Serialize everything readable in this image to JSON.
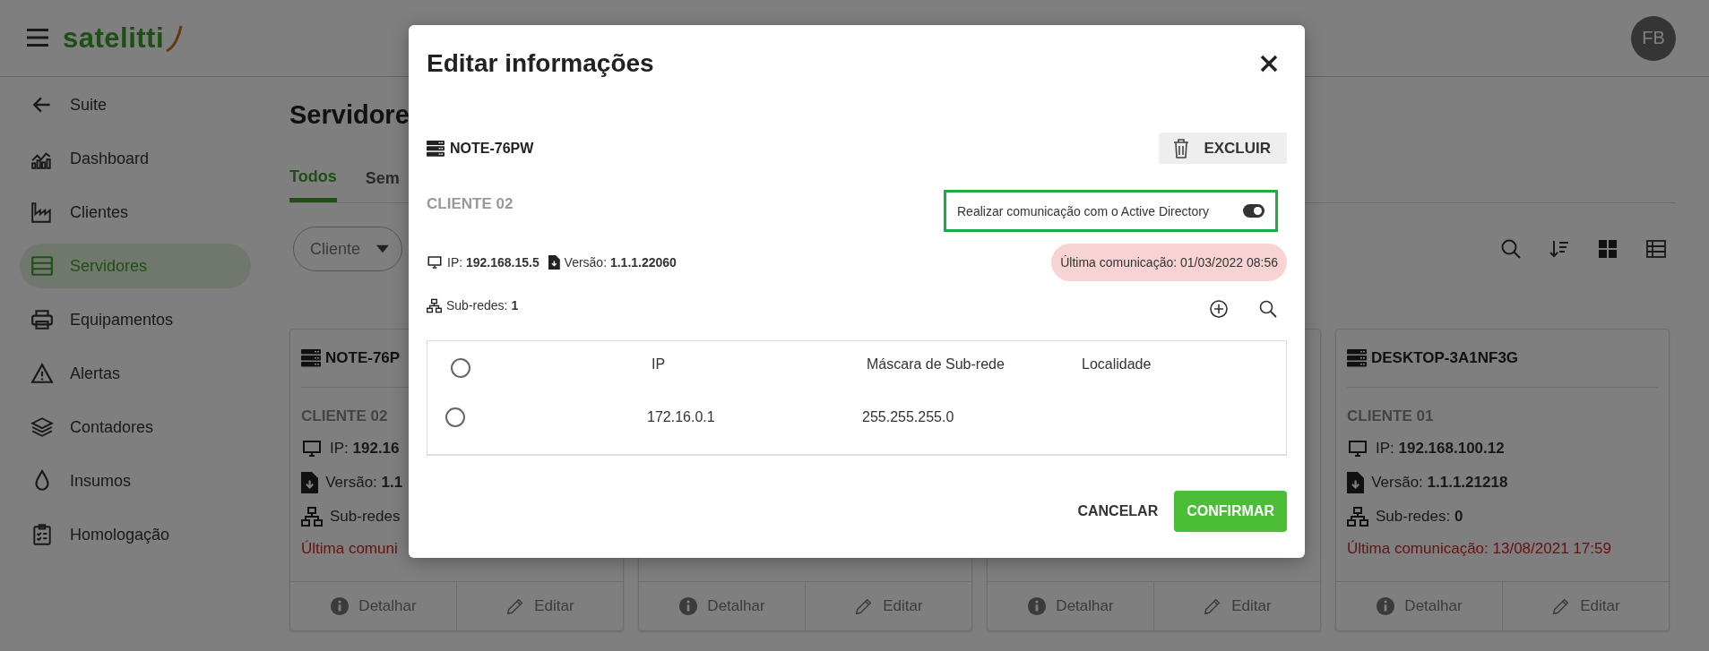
{
  "header": {
    "logo": "satelitti",
    "avatar": "FB"
  },
  "sidebar": {
    "items": [
      {
        "label": "Suite",
        "selected": false
      },
      {
        "label": "Dashboard",
        "selected": false
      },
      {
        "label": "Clientes",
        "selected": false
      },
      {
        "label": "Servidores",
        "selected": true
      },
      {
        "label": "Equipamentos",
        "selected": false
      },
      {
        "label": "Alertas",
        "selected": false
      },
      {
        "label": "Contadores",
        "selected": false
      },
      {
        "label": "Insumos",
        "selected": false
      },
      {
        "label": "Homologação",
        "selected": false
      }
    ]
  },
  "page": {
    "title": "Servidore",
    "tabs": [
      {
        "label": "Todos",
        "selected": true
      },
      {
        "label": "Sem",
        "selected": false
      }
    ],
    "filter": {
      "value": "Cliente"
    }
  },
  "cards": [
    {
      "name": "NOTE-76P",
      "client": "CLIENTE 02",
      "lines": [
        "IP: **192.16**",
        "Versão: **1.1**",
        "Sub-redes"
      ],
      "last_communication": "Última comuni",
      "actions": [
        "Detalhar",
        "Editar"
      ]
    },
    {
      "actions": [
        "Detalhar",
        "Editar"
      ]
    },
    {
      "actions": [
        "Detalhar",
        "Editar"
      ]
    },
    {
      "name": "DESKTOP-3A1NF3G",
      "client": "CLIENTE 01",
      "lines": [
        "IP: **192.168.100.12**",
        "Versão: **1.1.1.21218**",
        "Sub-redes: **0**"
      ],
      "last_communication": "Última comunicação: 13/08/2021 17:59",
      "actions": [
        "Detalhar",
        "Editar"
      ]
    }
  ],
  "dialog": {
    "title": "Editar informações",
    "server_name": "NOTE-76PW",
    "delete_button": "EXCLUIR",
    "client": "CLIENTE 02",
    "active_directory": {
      "label": "Realizar comunicação com o Active Directory",
      "on": true
    },
    "ip": "IP: **192.168.15.5**",
    "version": "Versão: **1.1.1.22060**",
    "last_communication": "Última comunicação: 01/03/2022 08:56",
    "subnets": "Sub-redes: **1**",
    "table": {
      "all_selected": false,
      "columns": [
        "IP",
        "Máscara de Sub-rede",
        "Localidade"
      ],
      "rows": [
        {
          "selected": false,
          "cells": [
            "172.16.0.1",
            "255.255.255.0",
            ""
          ]
        }
      ]
    },
    "buttons": {
      "cancel": "CANCELAR",
      "confirm": "CONFIRMAR"
    }
  }
}
